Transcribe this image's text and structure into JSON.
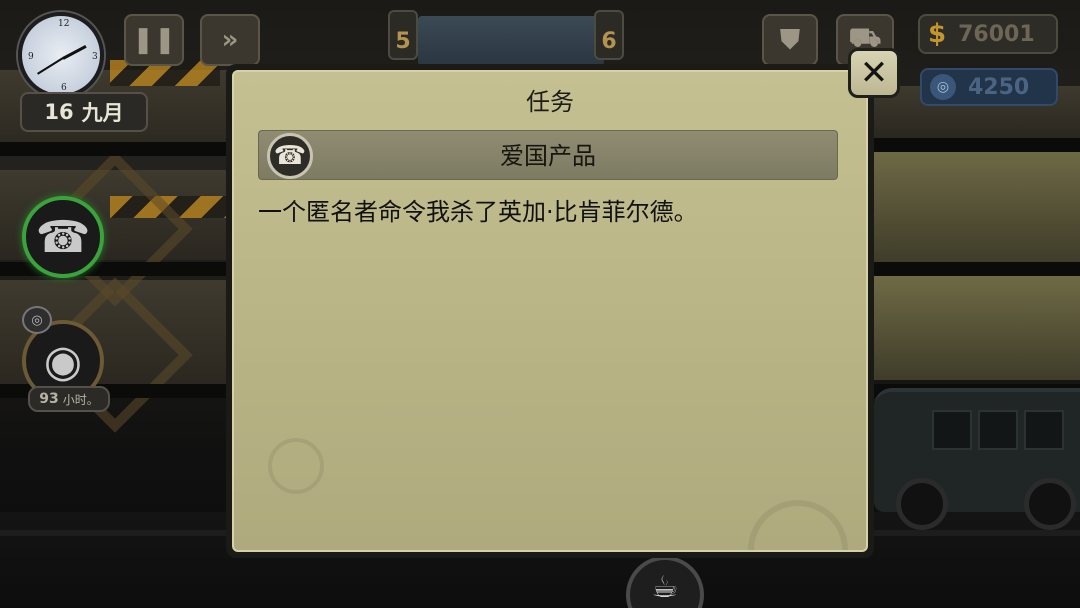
{
  "hud": {
    "date_day": "16",
    "date_month": "九月",
    "pause_icon": "pause-icon",
    "fast_forward_icon": "fast-forward-icon",
    "floor_left": "5",
    "floor_right": "6",
    "money_symbol": "$",
    "money": "76001",
    "tokens": "4250",
    "bag_icon": "bag-icon",
    "cart_icon": "cart-icon"
  },
  "side": {
    "phone_icon": "phone-icon",
    "spy_icon": "spy-icon",
    "hours_value": "93",
    "hours_unit": "小时。"
  },
  "dialog": {
    "title": "任务",
    "mission_name": "爱国产品",
    "mission_description": "一个匿名者命令我杀了英加·比肯菲尔德。",
    "close_icon": "close-icon"
  },
  "bottom": {
    "coffee_icon": "coffee-icon"
  },
  "colors": {
    "dialog_bg": "#bcb88a",
    "mission_bar": "#857f67",
    "money": "#c2962c",
    "token": "#3a5678",
    "active_ring": "#3aa33c"
  }
}
